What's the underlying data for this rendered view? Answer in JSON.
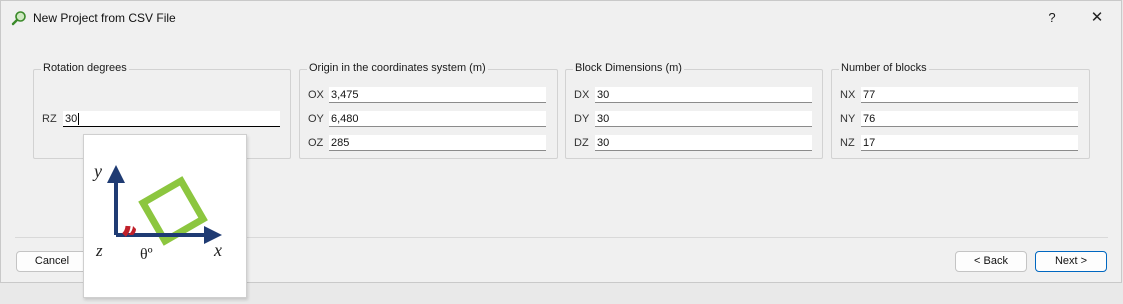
{
  "window": {
    "title": "New Project from CSV File",
    "help_label": "?",
    "close_label": "✕"
  },
  "groups": {
    "rotation": {
      "title": "Rotation degrees",
      "fields": [
        {
          "label": "RZ",
          "value": "30"
        }
      ]
    },
    "origin": {
      "title": "Origin in the coordinates system (m)",
      "fields": [
        {
          "label": "OX",
          "value": "3,475"
        },
        {
          "label": "OY",
          "value": "6,480"
        },
        {
          "label": "OZ",
          "value": "285"
        }
      ]
    },
    "dimensions": {
      "title": "Block Dimensions (m)",
      "fields": [
        {
          "label": "DX",
          "value": "30"
        },
        {
          "label": "DY",
          "value": "30"
        },
        {
          "label": "DZ",
          "value": "30"
        }
      ]
    },
    "blocks": {
      "title": "Number of blocks",
      "fields": [
        {
          "label": "NX",
          "value": "77"
        },
        {
          "label": "NY",
          "value": "76"
        },
        {
          "label": "NZ",
          "value": "17"
        }
      ]
    }
  },
  "buttons": {
    "cancel": "Cancel",
    "back": "< Back",
    "next": "Next >"
  },
  "tooltip": {
    "y_label": "y",
    "x_label": "x",
    "z_label": "z",
    "angle_label": "θº"
  },
  "colors": {
    "axis": "#1f3b73",
    "square": "#8cc63f",
    "angle_arc": "#c0202a",
    "accent": "#0067c0"
  }
}
